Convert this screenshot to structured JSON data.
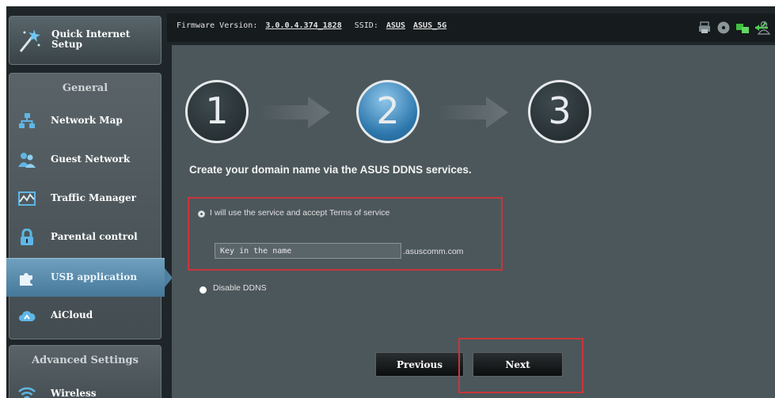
{
  "sidebar": {
    "quick_setup": {
      "line1": "Quick Internet",
      "line2": "Setup"
    },
    "general_header": "General",
    "items": [
      {
        "label": "Network Map",
        "icon": "network-map-icon"
      },
      {
        "label": "Guest Network",
        "icon": "guest-network-icon"
      },
      {
        "label": "Traffic Manager",
        "icon": "traffic-manager-icon"
      },
      {
        "label": "Parental control",
        "icon": "lock-icon"
      },
      {
        "label": "USB application",
        "icon": "puzzle-icon",
        "selected": true
      },
      {
        "label": "AiCloud",
        "icon": "cloud-icon"
      }
    ],
    "advanced_header": "Advanced Settings",
    "advanced_items": [
      {
        "label": "Wireless",
        "icon": "wifi-icon"
      }
    ]
  },
  "topbar": {
    "firmware_label": "Firmware Version:",
    "firmware_version": "3.0.0.4.374_1828",
    "ssid_label": "SSID:",
    "ssid_1": "ASUS",
    "ssid_2": "ASUS_5G",
    "status_icons": [
      "printer-icon",
      "disc-icon",
      "network-status-icon",
      "usb-icon",
      "user-icon"
    ]
  },
  "wizard": {
    "steps": [
      "1",
      "2",
      "3"
    ],
    "active_step": 2,
    "heading": "Create your domain name via the ASUS DDNS services.",
    "option_accept_label": "I will use the service and accept Terms of service",
    "domain_input": {
      "placeholder": "Key in the name",
      "suffix": ".asuscomm.com"
    },
    "option_disable_label": "Disable DDNS",
    "previous_button": "Previous",
    "next_button": "Next"
  },
  "colors": {
    "background": "#1f2629",
    "panel": "#4c575b",
    "active_step": "#2e78ad",
    "selected_nav": "#46789a",
    "highlight_box": "#c8363b"
  }
}
